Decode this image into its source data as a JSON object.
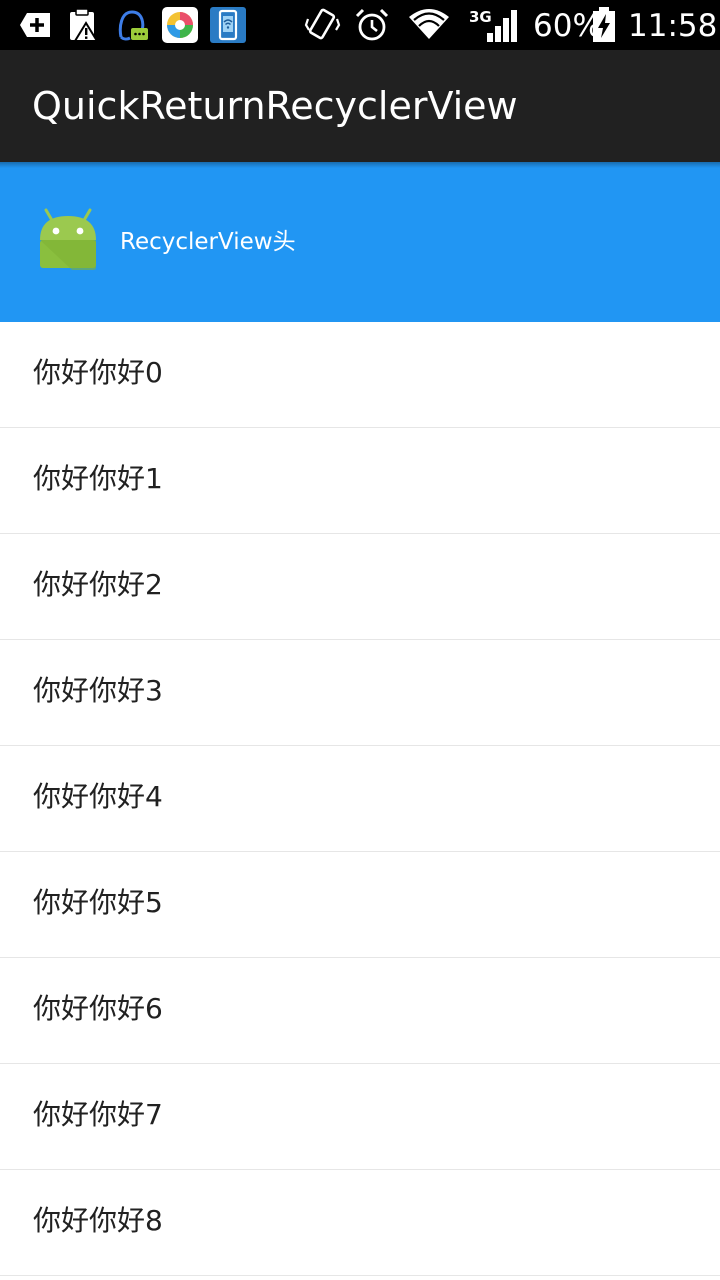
{
  "status_bar": {
    "battery_percent": "60%",
    "time": "11:58",
    "network_type": "3G",
    "icons": [
      "add-notification-icon",
      "clipboard-warning-icon",
      "qq-icon",
      "app-store-icon",
      "phone-wifi-icon",
      "vibrate-icon",
      "alarm-icon",
      "wifi-icon",
      "signal-icon",
      "battery-charging-icon"
    ]
  },
  "action_bar": {
    "title": "QuickReturnRecyclerView"
  },
  "header": {
    "icon": "android-icon",
    "text": "RecyclerView头",
    "color": "#2196F3"
  },
  "list": {
    "items": [
      "你好你好0",
      "你好你好1",
      "你好你好2",
      "你好你好3",
      "你好你好4",
      "你好你好5",
      "你好你好6",
      "你好你好7",
      "你好你好8"
    ]
  }
}
